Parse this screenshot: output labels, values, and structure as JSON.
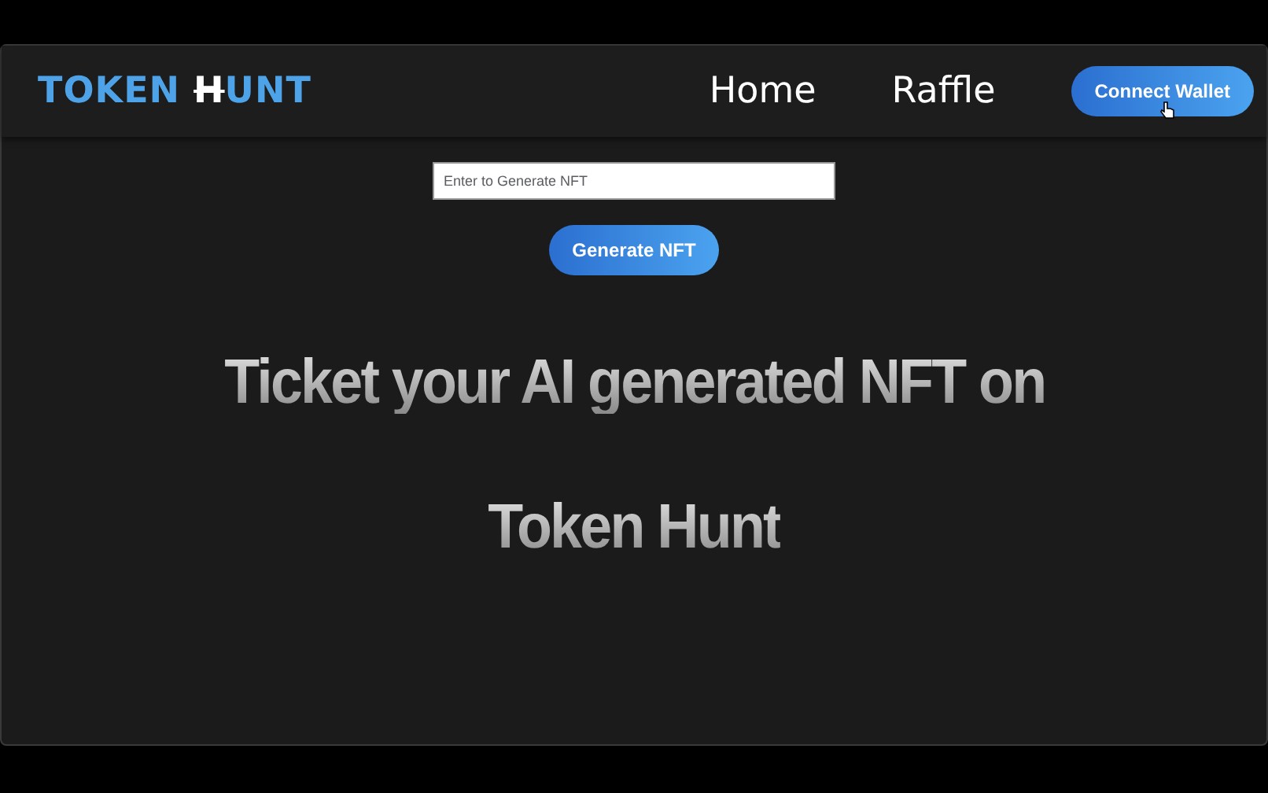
{
  "navbar": {
    "logo": {
      "before": "TOKEN ",
      "mark": "H",
      "after": "UNT"
    },
    "links": [
      {
        "label": "Home"
      },
      {
        "label": "Raffle"
      }
    ],
    "connect_button": {
      "label": "Connect Wallet",
      "hovered": true
    }
  },
  "generator": {
    "placeholder": "Enter to Generate NFT",
    "button": "Generate NFT"
  },
  "headline": [
    "Ticket your AI generated NFT on",
    "Token Hunt"
  ]
}
